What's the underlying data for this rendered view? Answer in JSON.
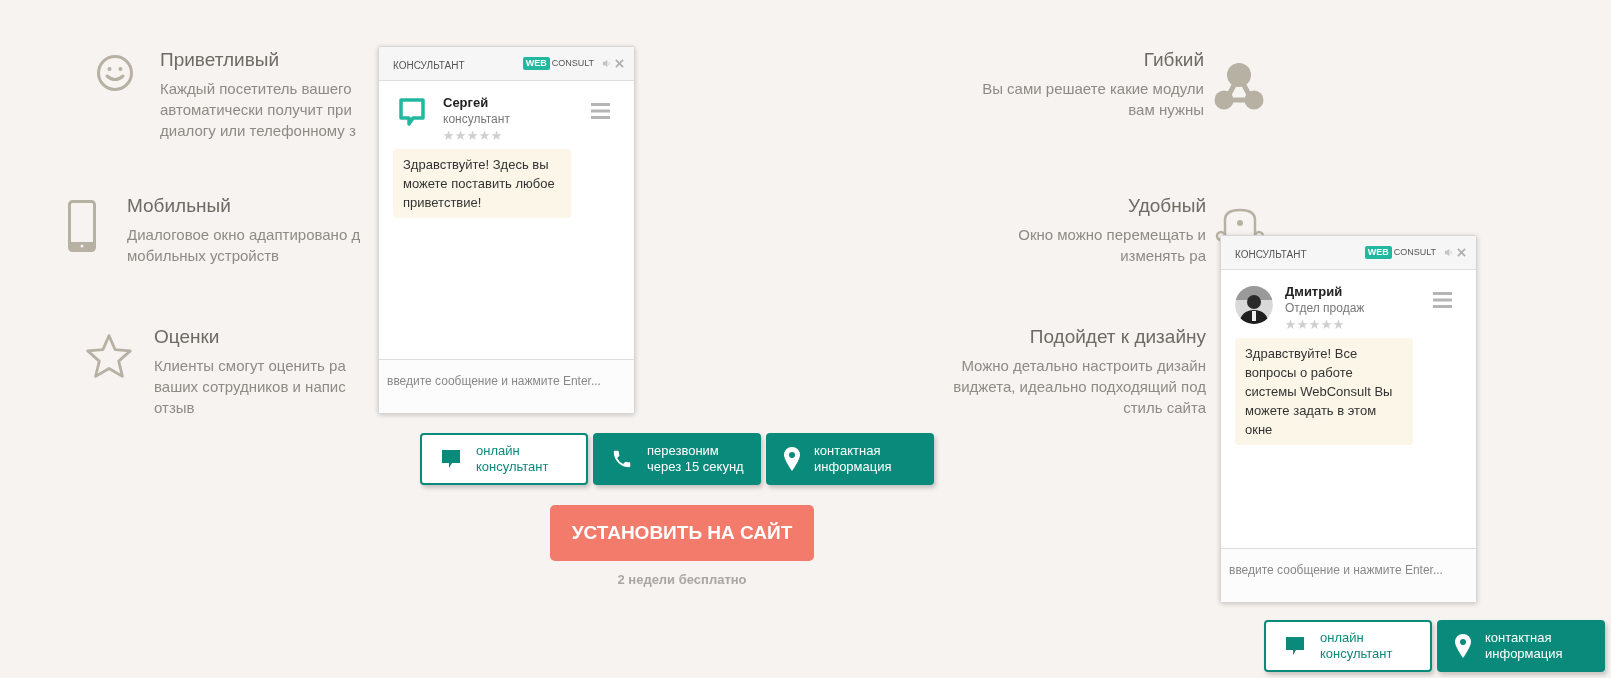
{
  "left_features": [
    {
      "title": "Приветливый",
      "lines": [
        "Каждый посетитель вашего",
        "автоматически получит при",
        "диалогу или телефонному з"
      ]
    },
    {
      "title": "Мобильный",
      "lines": [
        "Диалоговое окно адаптировано д",
        "мобильных устройств"
      ]
    },
    {
      "title": "Оценки",
      "lines": [
        "Клиенты смогут оценить ра",
        "ваших сотрудников и напис",
        "отзыв"
      ]
    }
  ],
  "right_features": [
    {
      "title": "Гибкий",
      "lines": [
        "Вы сами решаете какие модули",
        "вам нужны"
      ]
    },
    {
      "title": "Удобный",
      "lines": [
        "Окно можно перемещать и",
        "изменять ра"
      ]
    },
    {
      "title": "Подойдет к дизайну",
      "lines": [
        "Можно детально настроить дизайн",
        "виджета, идеально подходящий под",
        "стиль сайта"
      ]
    }
  ],
  "widgets": [
    {
      "header": "КОНСУЛЬТАНТ",
      "brand_web": "WEB",
      "brand_consult": "CONSULT",
      "kind": "icon",
      "agent_name": "Сергей",
      "agent_role": "консультант",
      "stars": 0,
      "message": "Здравствуйте! Здесь вы можете поставить любое приветствие!",
      "placeholder": "введите сообщение и нажмите Enter...",
      "buttons": [
        {
          "kind": "chat",
          "lines": [
            "онлайн",
            "консультант"
          ],
          "selected": true
        },
        {
          "kind": "call",
          "lines": [
            "перезвоним",
            "через 15 секунд"
          ],
          "selected": false
        },
        {
          "kind": "contacts",
          "lines": [
            "контактная",
            "информация"
          ],
          "selected": false
        }
      ]
    },
    {
      "header": "КОНСУЛЬТАНТ",
      "brand_web": "WEB",
      "brand_consult": "CONSULT",
      "kind": "picture",
      "agent_name": "Дмитрий",
      "agent_role": "Отдел продаж",
      "stars": 0,
      "message": "Здравствуйте! Все вопросы о работе системы WebConsult Вы можете задать в этом окне",
      "placeholder": "введите сообщение и нажмите Enter...",
      "buttons": [
        {
          "kind": "chat",
          "lines": [
            "онлайн",
            "консультант"
          ],
          "selected": true
        },
        {
          "kind": "contacts",
          "lines": [
            "контактная",
            "информация"
          ],
          "selected": false
        }
      ]
    }
  ],
  "install_button": "УСТАНОВИТЬ НА САЙТ",
  "install_note": "2 недели бесплатно"
}
